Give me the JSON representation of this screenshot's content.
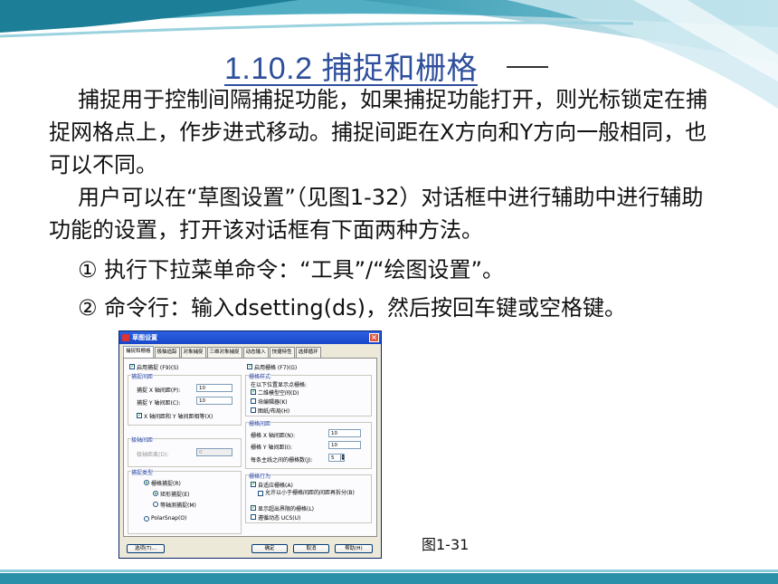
{
  "title": "1.10.2  捕捉和栅格",
  "paragraphs": {
    "p1": "捕捉用于控制间隔捕捉功能，如果捕捉功能打开，则光标锁定在捕捉网格点上，作步进式移动。捕捉间距在X方向和Y方向一般相同，也可以不同。",
    "p2": "用户可以在“草图设置”（见图1-32）对话框中进行辅助中进行辅助功能的设置，打开该对话框有下面两种方法。",
    "p3": "① 执行下拉菜单命令：“工具”/“绘图设置”。",
    "p4": "② 命令行：输入dsetting(ds)，然后按回车键或空格键。"
  },
  "dialog": {
    "title": "草图设置",
    "tabs": [
      "捕捉和栅格",
      "极轴追踪",
      "对象捕捉",
      "三维对象捕捉",
      "动态输入",
      "快捷特性",
      "选择循环"
    ],
    "snap_on": "启用捕捉 (F9)(S)",
    "grid_on": "启用栅格 (F7)(G)",
    "snap_spacing": {
      "label": "捕捉间距",
      "x_label": "捕捉 X 轴间距(P):",
      "x_value": "10",
      "y_label": "捕捉 Y 轴间距(C):",
      "y_value": "10",
      "equal": "X 轴间距和 Y 轴间距相等(X)"
    },
    "polar_spacing": {
      "label": "极轴间距",
      "dist_label": "极轴距离(D):",
      "dist_value": "0"
    },
    "snap_type": {
      "label": "捕捉类型",
      "grid_snap": "栅格捕捉(R)",
      "rect_snap": "矩形捕捉(E)",
      "iso_snap": "等轴测捕捉(M)",
      "polar_snap": "PolarSnap(O)"
    },
    "grid_style": {
      "label": "栅格样式",
      "hint": "在以下位置显示点栅格:",
      "model": "二维模型空间(D)",
      "block": "块编辑器(K)",
      "sheet": "图纸/布局(H)"
    },
    "grid_spacing": {
      "label": "栅格间距",
      "x_label": "栅格 X 轴间距(N):",
      "x_value": "10",
      "y_label": "栅格 Y 轴间距(I):",
      "y_value": "10",
      "major_label": "每条主线之间的栅格数(J):",
      "major_value": "5"
    },
    "grid_behavior": {
      "label": "栅格行为",
      "adaptive": "自适应栅格(A)",
      "subdivide": "允许以小于栅格间距的间距再拆分(B)",
      "beyond": "显示超出界限的栅格(L)",
      "follow": "遵循动态 UCS(U)"
    },
    "buttons": {
      "options": "选项(T)...",
      "ok": "确定",
      "cancel": "取消",
      "help": "帮助(H)"
    }
  },
  "caption": "图1-31",
  "colors": {
    "title": "#2E4F9C",
    "accent_teal": "#56B4C8"
  }
}
